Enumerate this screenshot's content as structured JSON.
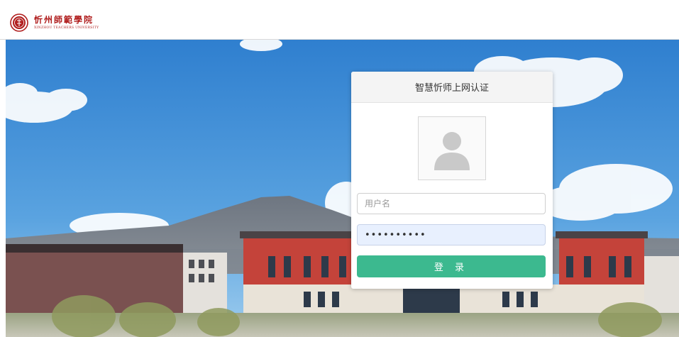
{
  "header": {
    "logo_cn": "忻州師範學院",
    "logo_en": "XINZHOU TEACHERS UNIVERSITY"
  },
  "login": {
    "title": "智慧忻师上网认证",
    "username_placeholder": "用户名",
    "password_value": "••••••••••",
    "submit_label": "登 录",
    "button_color": "#3cb98f"
  },
  "icons": {
    "logo": "university-seal-icon",
    "avatar": "user-avatar-icon"
  }
}
